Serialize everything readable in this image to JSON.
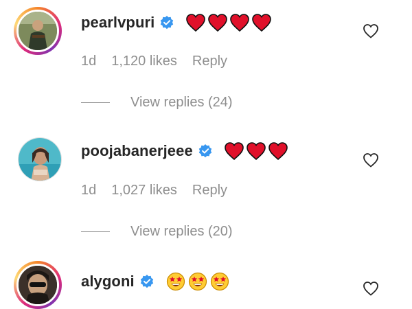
{
  "comments": [
    {
      "username": "pearlvpuri",
      "verified": true,
      "emoji_icons": [
        "red-heart-icon",
        "red-heart-icon",
        "red-heart-icon",
        "red-heart-icon"
      ],
      "time": "1d",
      "likes": "1,120 likes",
      "reply_label": "Reply",
      "view_replies": "View replies (24)"
    },
    {
      "username": "poojabanerjeee",
      "verified": true,
      "emoji_icons": [
        "red-heart-icon",
        "red-heart-icon",
        "red-heart-icon"
      ],
      "time": "1d",
      "likes": "1,027 likes",
      "reply_label": "Reply",
      "view_replies": "View replies (20)"
    },
    {
      "username": "alygoni",
      "verified": true,
      "emoji_icons": [
        "star-struck-emoji-icon",
        "star-struck-emoji-icon",
        "star-struck-emoji-icon"
      ]
    }
  ],
  "colors": {
    "verified_blue": "#3897f0",
    "heart_red": "#e0102a",
    "meta_gray": "#8e8e8e",
    "text": "#262626"
  }
}
